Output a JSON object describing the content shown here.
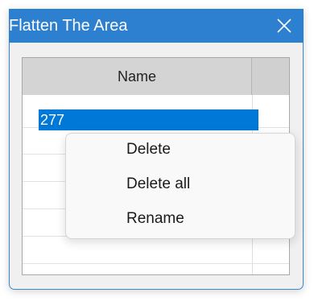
{
  "window": {
    "title": "Flatten The Area"
  },
  "grid": {
    "columns": [
      "Name"
    ],
    "rows": [
      "277"
    ]
  },
  "context_menu": {
    "items": [
      "Delete",
      "Delete all",
      "Rename"
    ]
  },
  "icons": {
    "close": "close-icon"
  },
  "colors": {
    "titlebar": "#2d7fd0",
    "selection": "#0078d7",
    "header": "#d4d4d4"
  }
}
